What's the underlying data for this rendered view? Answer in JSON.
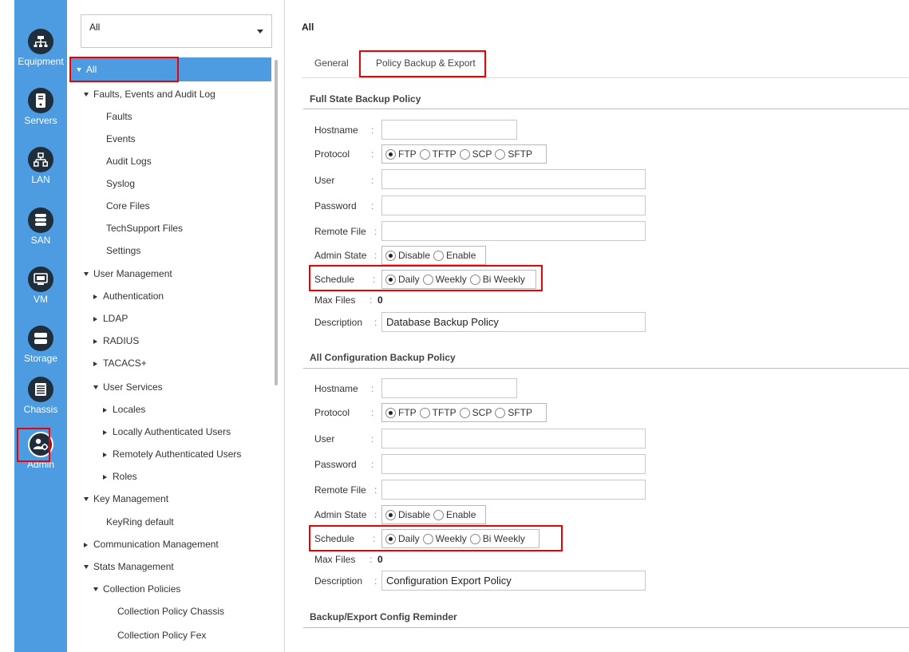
{
  "rail": {
    "items": [
      {
        "label": "Equipment",
        "icon": "equipment-icon"
      },
      {
        "label": "Servers",
        "icon": "servers-icon"
      },
      {
        "label": "LAN",
        "icon": "lan-icon"
      },
      {
        "label": "SAN",
        "icon": "san-icon"
      },
      {
        "label": "VM",
        "icon": "vm-icon"
      },
      {
        "label": "Storage",
        "icon": "storage-icon"
      },
      {
        "label": "Chassis",
        "icon": "chassis-icon"
      },
      {
        "label": "Admin",
        "icon": "admin-icon"
      }
    ],
    "active": "Admin",
    "colors": {
      "rail_bg": "#4d9be0",
      "icon_bg": "#1f2e3a",
      "highlight": "#e00000"
    }
  },
  "nav": {
    "filter_value": "All",
    "selected": "All",
    "tree": [
      {
        "label": "Faults, Events and Audit Log",
        "expanded": true
      },
      {
        "label": "Faults"
      },
      {
        "label": "Events"
      },
      {
        "label": "Audit Logs"
      },
      {
        "label": "Syslog"
      },
      {
        "label": "Core Files"
      },
      {
        "label": "TechSupport Files"
      },
      {
        "label": "Settings"
      },
      {
        "label": "User Management",
        "expanded": true
      },
      {
        "label": "Authentication",
        "expanded": false
      },
      {
        "label": "LDAP",
        "expanded": false
      },
      {
        "label": "RADIUS",
        "expanded": false
      },
      {
        "label": "TACACS+",
        "expanded": false
      },
      {
        "label": "User Services",
        "expanded": true
      },
      {
        "label": "Locales",
        "expanded": false
      },
      {
        "label": "Locally Authenticated Users",
        "expanded": false
      },
      {
        "label": "Remotely Authenticated Users",
        "expanded": false
      },
      {
        "label": "Roles",
        "expanded": false
      },
      {
        "label": "Key Management",
        "expanded": true
      },
      {
        "label": "KeyRing default"
      },
      {
        "label": "Communication Management",
        "expanded": false
      },
      {
        "label": "Stats Management",
        "expanded": true
      },
      {
        "label": "Collection Policies",
        "expanded": true
      },
      {
        "label": "Collection Policy Chassis"
      },
      {
        "label": "Collection Policy Fex"
      }
    ]
  },
  "main": {
    "title": "All",
    "tabs": [
      {
        "label": "General",
        "active": false
      },
      {
        "label": "Policy Backup & Export",
        "active": true
      }
    ],
    "labels": {
      "hostname": "Hostname",
      "protocol": "Protocol",
      "user": "User",
      "password": "Password",
      "remote_file": "Remote File",
      "admin_state": "Admin State",
      "schedule": "Schedule",
      "max_files": "Max Files",
      "description": "Description"
    },
    "protocol_options": [
      "FTP",
      "TFTP",
      "SCP",
      "SFTP"
    ],
    "admin_state_options": [
      "Disable",
      "Enable"
    ],
    "schedule_options": [
      "Daily",
      "Weekly",
      "Bi Weekly"
    ],
    "full_state": {
      "title": "Full State Backup Policy",
      "hostname": "",
      "protocol": "FTP",
      "user": "",
      "password": "",
      "remote_file": "",
      "admin_state": "Disable",
      "schedule": "Daily",
      "max_files": "0",
      "description": "Database Backup Policy"
    },
    "all_config": {
      "title": "All Configuration Backup Policy",
      "hostname": "",
      "protocol": "FTP",
      "user": "",
      "password": "",
      "remote_file": "",
      "admin_state": "Disable",
      "schedule": "Daily",
      "max_files": "0",
      "description": "Configuration Export Policy"
    },
    "reminder_title": "Backup/Export Config Reminder"
  }
}
